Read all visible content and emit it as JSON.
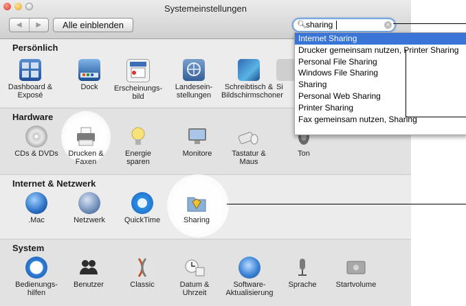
{
  "window": {
    "title": "Systemeinstellungen"
  },
  "toolbar": {
    "back": "◀",
    "forward": "▶",
    "show_all": "Alle einblenden"
  },
  "search": {
    "value": "sharing",
    "clear": "×"
  },
  "sections": {
    "personal": {
      "title": "Persönlich",
      "items": [
        {
          "label": "Dashboard &\nExposé",
          "icon": "dashboard-expose-icon"
        },
        {
          "label": "Dock",
          "icon": "dock-icon"
        },
        {
          "label": "Erscheinungs-\nbild",
          "icon": "appearance-icon"
        },
        {
          "label": "Landesein-\nstellungen",
          "icon": "international-icon"
        },
        {
          "label": "Schreibtisch &\nBildschirmschoner",
          "icon": "desktop-screensaver-icon"
        },
        {
          "label": "Si",
          "icon": "security-icon"
        }
      ]
    },
    "hardware": {
      "title": "Hardware",
      "items": [
        {
          "label": "CDs & DVDs",
          "icon": "cd-dvd-icon"
        },
        {
          "label": "Drucken &\nFaxen",
          "icon": "printer-icon"
        },
        {
          "label": "Energie\nsparen",
          "icon": "lightbulb-icon"
        },
        {
          "label": "Monitore",
          "icon": "monitor-icon"
        },
        {
          "label": "Tastatur &\nMaus",
          "icon": "keyboard-mouse-icon"
        },
        {
          "label": "Ton",
          "icon": "speaker-icon"
        }
      ]
    },
    "internet": {
      "title": "Internet & Netzwerk",
      "items": [
        {
          "label": ".Mac",
          "icon": "dotmac-icon"
        },
        {
          "label": "Netzwerk",
          "icon": "network-globe-icon"
        },
        {
          "label": "QuickTime",
          "icon": "quicktime-icon"
        },
        {
          "label": "Sharing",
          "icon": "sharing-folder-icon"
        }
      ]
    },
    "system": {
      "title": "System",
      "items": [
        {
          "label": "Bedienungs-\nhilfen",
          "icon": "accessibility-icon"
        },
        {
          "label": "Benutzer",
          "icon": "users-icon"
        },
        {
          "label": "Classic",
          "icon": "classic-icon"
        },
        {
          "label": "Datum &\nUhrzeit",
          "icon": "date-time-icon"
        },
        {
          "label": "Software-\nAktualisierung",
          "icon": "software-update-icon"
        },
        {
          "label": "Sprache",
          "icon": "microphone-icon"
        },
        {
          "label": "Startvolume",
          "icon": "startup-disk-icon"
        }
      ]
    }
  },
  "search_results": [
    "Internet Sharing",
    "Drucker gemeinsam nutzen, Printer Sharing",
    "Personal File Sharing",
    "Windows File Sharing",
    "Sharing",
    "Personal Web Sharing",
    "Printer Sharing",
    "Fax gemeinsam nutzen, Sharing"
  ],
  "colors": {
    "selection": "#3875d7",
    "search_focus": "#7aa7dd"
  }
}
